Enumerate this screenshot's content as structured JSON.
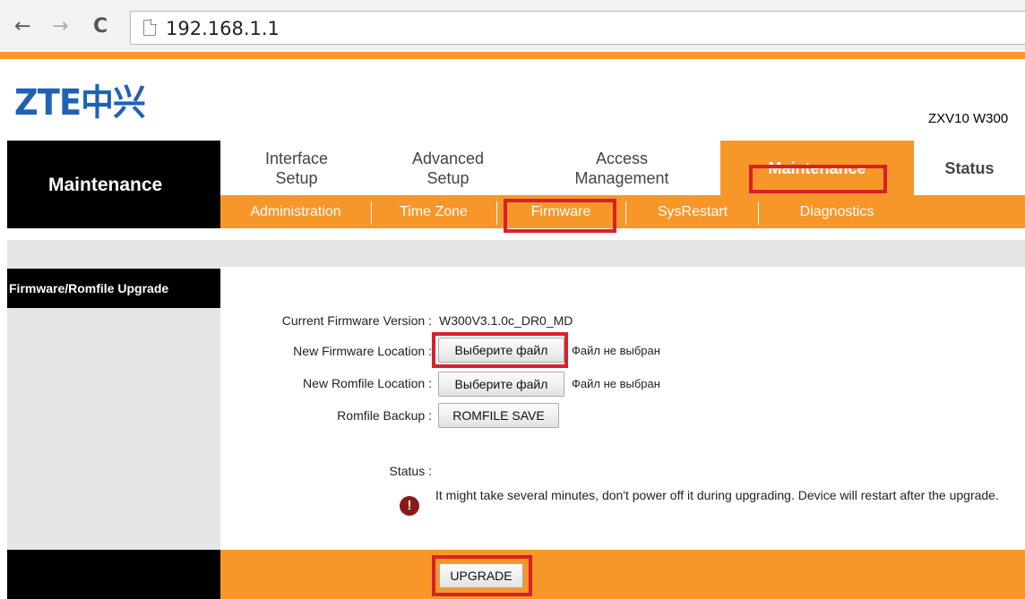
{
  "browser": {
    "back_icon": "←",
    "forward_icon": "→",
    "reload_icon": "C",
    "url": "192.168.1.1"
  },
  "header": {
    "logo_text": "ZTE中兴",
    "model": "ZXV10 W300"
  },
  "nav": {
    "section_title": "Maintenance",
    "tabs": [
      {
        "label": "Interface\nSetup"
      },
      {
        "label": "Advanced\nSetup"
      },
      {
        "label": "Access\nManagement"
      },
      {
        "label": "Maintenance"
      },
      {
        "label": "Status"
      }
    ],
    "subtabs": [
      {
        "label": "Administration"
      },
      {
        "label": "Time Zone"
      },
      {
        "label": "Firmware"
      },
      {
        "label": "SysRestart"
      },
      {
        "label": "Diagnostics"
      }
    ]
  },
  "sidebar": {
    "heading": "Firmware/Romfile Upgrade"
  },
  "form": {
    "current_fw_label": "Current Firmware Version :",
    "current_fw_value": "W300V3.1.0c_DR0_MD",
    "new_fw_label": "New Firmware Location :",
    "new_fw_button": "Выберите файл",
    "new_fw_status": "Файл не выбран",
    "new_rom_label": "New Romfile Location :",
    "new_rom_button": "Выберите файл",
    "new_rom_status": "Файл не выбран",
    "rom_backup_label": "Romfile Backup :",
    "rom_backup_button": "ROMFILE SAVE",
    "status_label": "Status :",
    "status_icon": "alert-icon",
    "status_message": "It might take several minutes, don't power off it during upgrading. Device will restart after the upgrade.",
    "upgrade_button": "UPGRADE"
  },
  "colors": {
    "accent": "#f7972a",
    "highlight": "#d9202a",
    "logo": "#1f62b5"
  }
}
